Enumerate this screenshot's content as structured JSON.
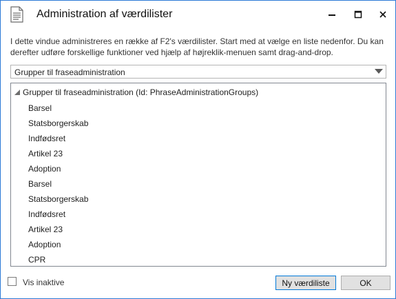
{
  "window": {
    "title": "Administration af værdilister"
  },
  "description": "I dette vindue administreres en række af F2's værdilister. Start med at vælge en liste nedenfor. Du kan derefter udføre forskellige funktioner ved hjælp af højreklik-menuen samt drag-and-drop.",
  "list_selector": {
    "selected": "Grupper til fraseadministration"
  },
  "tree": {
    "root_label": "Grupper til fraseadministration (Id: PhraseAdministrationGroups)",
    "items": [
      "Barsel",
      "Statsborgerskab",
      "Indfødsret",
      "Artikel 23",
      "Adoption",
      "Barsel",
      "Statsborgerskab",
      "Indfødsret",
      "Artikel 23",
      "Adoption",
      "CPR"
    ]
  },
  "footer": {
    "show_inactive_label": "Vis inaktive",
    "show_inactive_checked": false,
    "new_list_button": "Ny værdiliste",
    "ok_button": "OK"
  },
  "colors": {
    "window_border": "#2b79d6",
    "button_focus_border": "#0078d7"
  }
}
